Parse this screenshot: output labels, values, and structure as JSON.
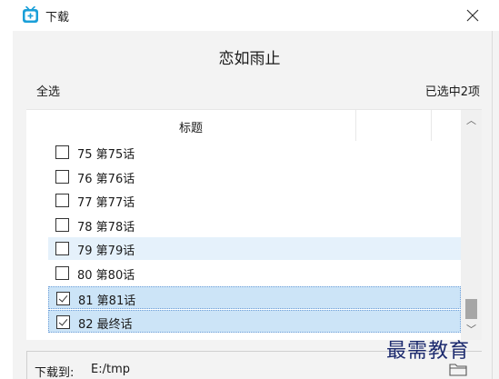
{
  "window": {
    "title": "下载",
    "close_glyph": "✕"
  },
  "comic": {
    "title": "恋如雨止"
  },
  "toolbar": {
    "select_all": "全选",
    "selected_count": "已选中2项"
  },
  "list": {
    "header_title": "标题",
    "rows": [
      {
        "label": "75 第75话",
        "checked": false,
        "state": "normal"
      },
      {
        "label": "76 第76话",
        "checked": false,
        "state": "normal"
      },
      {
        "label": "77 第77话",
        "checked": false,
        "state": "normal"
      },
      {
        "label": "78 第78话",
        "checked": false,
        "state": "normal"
      },
      {
        "label": "79 第79话",
        "checked": false,
        "state": "hover"
      },
      {
        "label": "80 第80话",
        "checked": false,
        "state": "normal"
      },
      {
        "label": "81 第81话",
        "checked": true,
        "state": "selected"
      },
      {
        "label": "82 最终话",
        "checked": true,
        "state": "selected"
      }
    ],
    "scroll_up_glyph": "︿",
    "scroll_down_glyph": "﹀"
  },
  "footer": {
    "download_to_label": "下载到:",
    "path": "E:/tmp"
  },
  "watermark": {
    "text": "最需教育"
  },
  "colors": {
    "accent": "#1a9fd8",
    "hover_row": "#e5f1fb",
    "selected_row": "#cce4f7"
  },
  "icons": {
    "app": "tv-app-icon",
    "close": "close-icon",
    "folder": "folder-icon",
    "scroll_up": "chevron-up-icon",
    "scroll_down": "chevron-down-icon"
  }
}
